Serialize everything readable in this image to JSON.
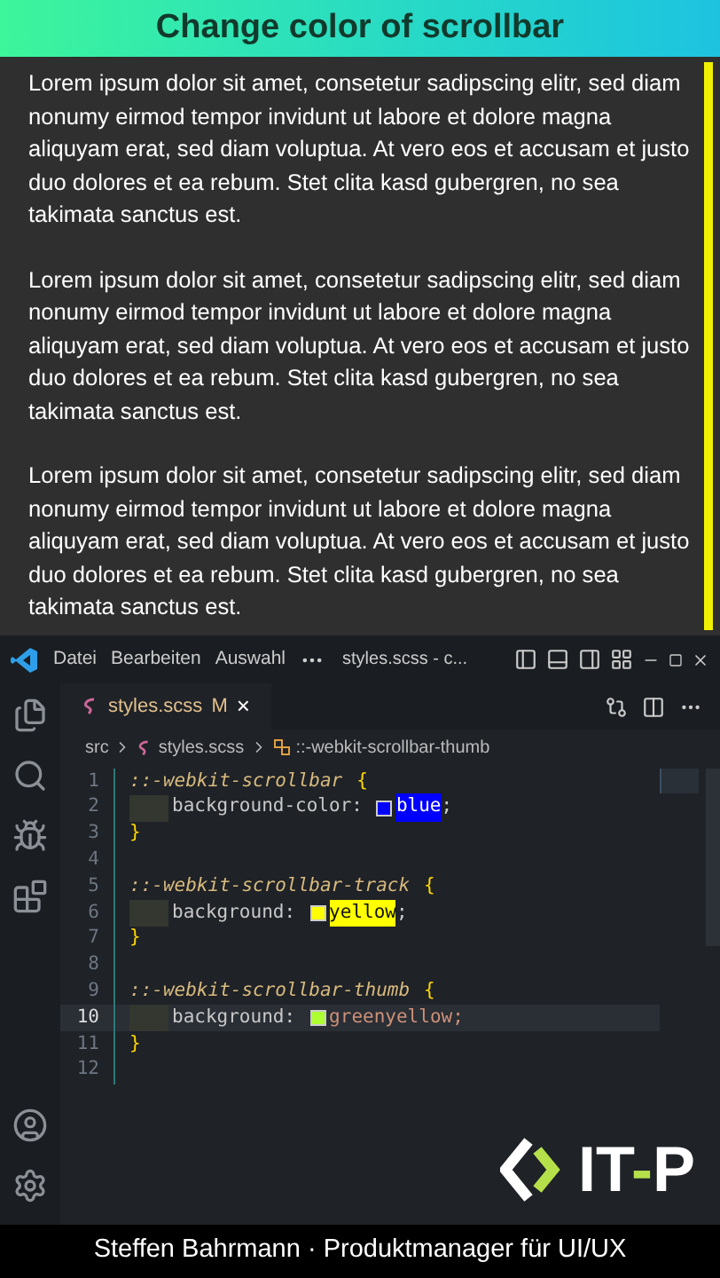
{
  "banner": {
    "title": "Change color of scrollbar"
  },
  "preview": {
    "paragraphs": [
      "Lorem ipsum dolor sit amet, consetetur sadipscing elitr, sed diam nonumy eirmod tempor invidunt ut labore et dolore magna aliquyam erat, sed diam voluptua. At vero eos et accusam et justo duo dolores et ea rebum. Stet clita kasd gubergren, no sea takimata sanctus est.",
      "Lorem ipsum dolor sit amet, consetetur sadipscing elitr, sed diam nonumy eirmod tempor invidunt ut labore et dolore magna aliquyam erat, sed diam voluptua. At vero eos et accusam et justo duo dolores et ea rebum. Stet clita kasd gubergren, no sea takimata sanctus est.",
      "Lorem ipsum dolor sit amet, consetetur sadipscing elitr, sed diam nonumy eirmod tempor invidunt ut labore et dolore magna aliquyam erat, sed diam voluptua. At vero eos et accusam et justo duo dolores et ea rebum. Stet clita kasd gubergren, no sea takimata sanctus est."
    ],
    "scrollbar": {
      "color": "#f0f000"
    }
  },
  "editor": {
    "menu": [
      "Datei",
      "Bearbeiten",
      "Auswahl"
    ],
    "window_title": "styles.scss - c...",
    "tab": {
      "label": "styles.scss",
      "badge": "M",
      "close": "×",
      "selected": true
    },
    "breadcrumb": [
      "src",
      "styles.scss",
      "::-webkit-scrollbar-thumb"
    ],
    "lines": [
      {
        "number": "1",
        "selected": false,
        "tokens": [
          {
            "kind": "selector",
            "text": "::-webkit-scrollbar"
          },
          {
            "kind": "brace",
            "text": "{"
          }
        ]
      },
      {
        "number": "2",
        "selected": false,
        "tokens": [
          {
            "kind": "property",
            "text": "background-color:"
          },
          {
            "kind": "swatch",
            "color": "#0000ff"
          },
          {
            "kind": "value",
            "text": "blue",
            "color": "#0000ff"
          },
          {
            "kind": "punct",
            "text": ";"
          }
        ]
      },
      {
        "number": "3",
        "selected": false,
        "tokens": [
          {
            "kind": "brace",
            "text": "}"
          }
        ]
      },
      {
        "number": "4",
        "selected": false
      },
      {
        "number": "5",
        "selected": false,
        "tokens": [
          {
            "kind": "selector",
            "text": "::-webkit-scrollbar-track"
          },
          {
            "kind": "brace",
            "text": "{"
          }
        ]
      },
      {
        "number": "6",
        "selected": false,
        "tokens": [
          {
            "kind": "property",
            "text": "background:"
          },
          {
            "kind": "swatch",
            "color": "#ffff00"
          },
          {
            "kind": "value",
            "text": "yellow",
            "color": "#ffff00"
          },
          {
            "kind": "punct",
            "text": ";"
          }
        ]
      },
      {
        "number": "7",
        "selected": false,
        "tokens": [
          {
            "kind": "brace",
            "text": "}"
          }
        ]
      },
      {
        "number": "8",
        "selected": false
      },
      {
        "number": "9",
        "selected": false,
        "tokens": [
          {
            "kind": "selector",
            "text": "::-webkit-scrollbar-thumb"
          },
          {
            "kind": "brace",
            "text": "{"
          }
        ]
      },
      {
        "number": "10",
        "selected": true,
        "tokens": [
          {
            "kind": "property",
            "text": "background:"
          },
          {
            "kind": "swatch",
            "color": "#adff2f"
          },
          {
            "kind": "plain",
            "text": "greenyellow;"
          }
        ]
      },
      {
        "number": "11",
        "selected": false,
        "tokens": [
          {
            "kind": "brace",
            "text": "}"
          }
        ]
      },
      {
        "number": "12",
        "selected": false
      }
    ]
  },
  "logo": {
    "left": "IT",
    "dash": "-",
    "right": "P"
  },
  "footer": {
    "text": "Steffen Bahrmann · Produktmanager für UI/UX"
  }
}
